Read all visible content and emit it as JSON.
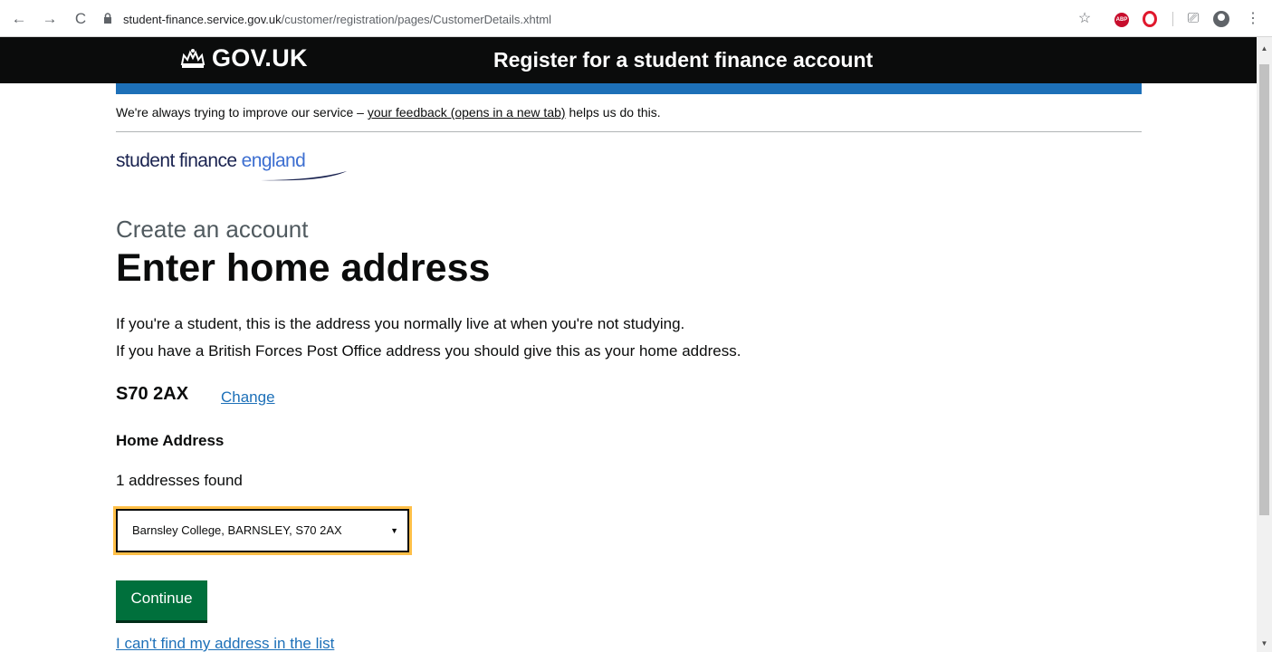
{
  "browser": {
    "url_host": "student-finance.service.gov.uk",
    "url_path": "/customer/registration/pages/CustomerDetails.xhtml",
    "back_glyph": "←",
    "forward_glyph": "→",
    "reload_glyph": "C",
    "star_glyph": "☆",
    "cast_glyph": "⎚",
    "menu_glyph": "⋮",
    "abp_label": "ABP",
    "icons": [
      "back-arrow-icon",
      "forward-arrow-icon",
      "reload-icon",
      "lock-icon",
      "star-icon",
      "adblock-icon",
      "opera-icon",
      "cast-icon",
      "profile-icon",
      "menu-icon"
    ]
  },
  "header": {
    "logo_text": "GOV.UK",
    "service_name": "Register for a student finance account"
  },
  "feedback": {
    "before": "We're always trying to improve our service – ",
    "link": "your feedback (opens in a new tab)",
    "after": " helps us do this."
  },
  "brand": {
    "part1": "student finance ",
    "part2": "england"
  },
  "page": {
    "caption": "Create an account",
    "title": "Enter home address",
    "body1": "If you're a student, this is the address you normally live at when you're not studying.",
    "body2": "If you have a British Forces Post Office address you should give this as your home address.",
    "postcode": "S70 2AX",
    "change_link": "Change",
    "address_label": "Home Address",
    "count_text": "1 addresses found",
    "selected_address": "Barnsley College, BARNSLEY, S70 2AX",
    "select_caret": "▼",
    "continue_label": "Continue",
    "cant_find_link": "I can't find my address in the list"
  },
  "colors": {
    "gov_black": "#0b0c0c",
    "gov_blue": "#1d70b8",
    "button_green": "#00703c",
    "focus_yellow": "#ffbf47"
  }
}
